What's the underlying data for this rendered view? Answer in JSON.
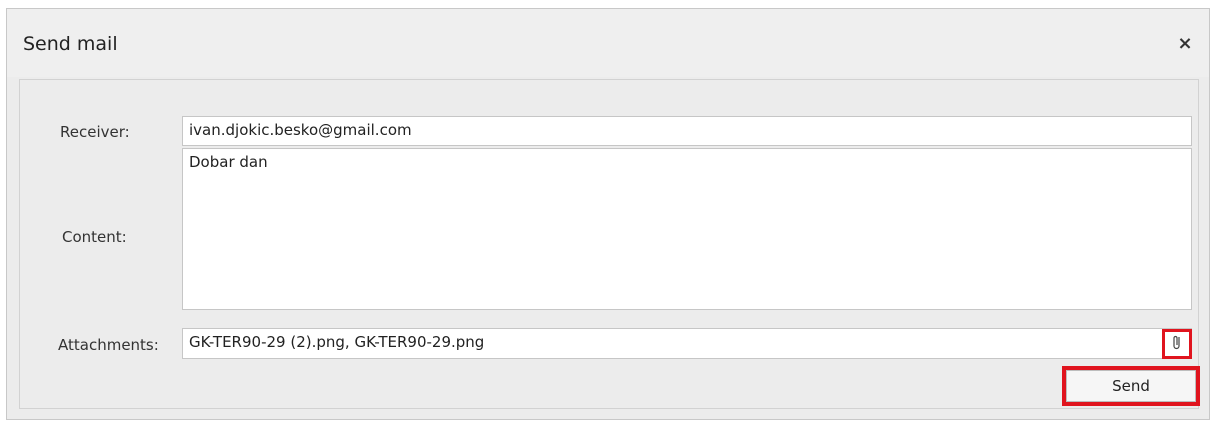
{
  "dialog": {
    "title": "Send mail",
    "close_label": "×"
  },
  "form": {
    "receiver_label": "Receiver:",
    "receiver_value": "ivan.djokic.besko@gmail.com",
    "content_label": "Content:",
    "content_value": "Dobar dan",
    "attachments_label": "Attachments:",
    "attachments_value": "GK-TER90-29 (2).png, GK-TER90-29.png",
    "attach_icon": "paperclip-icon",
    "send_label": "Send"
  },
  "highlight_color": "#e0141e"
}
